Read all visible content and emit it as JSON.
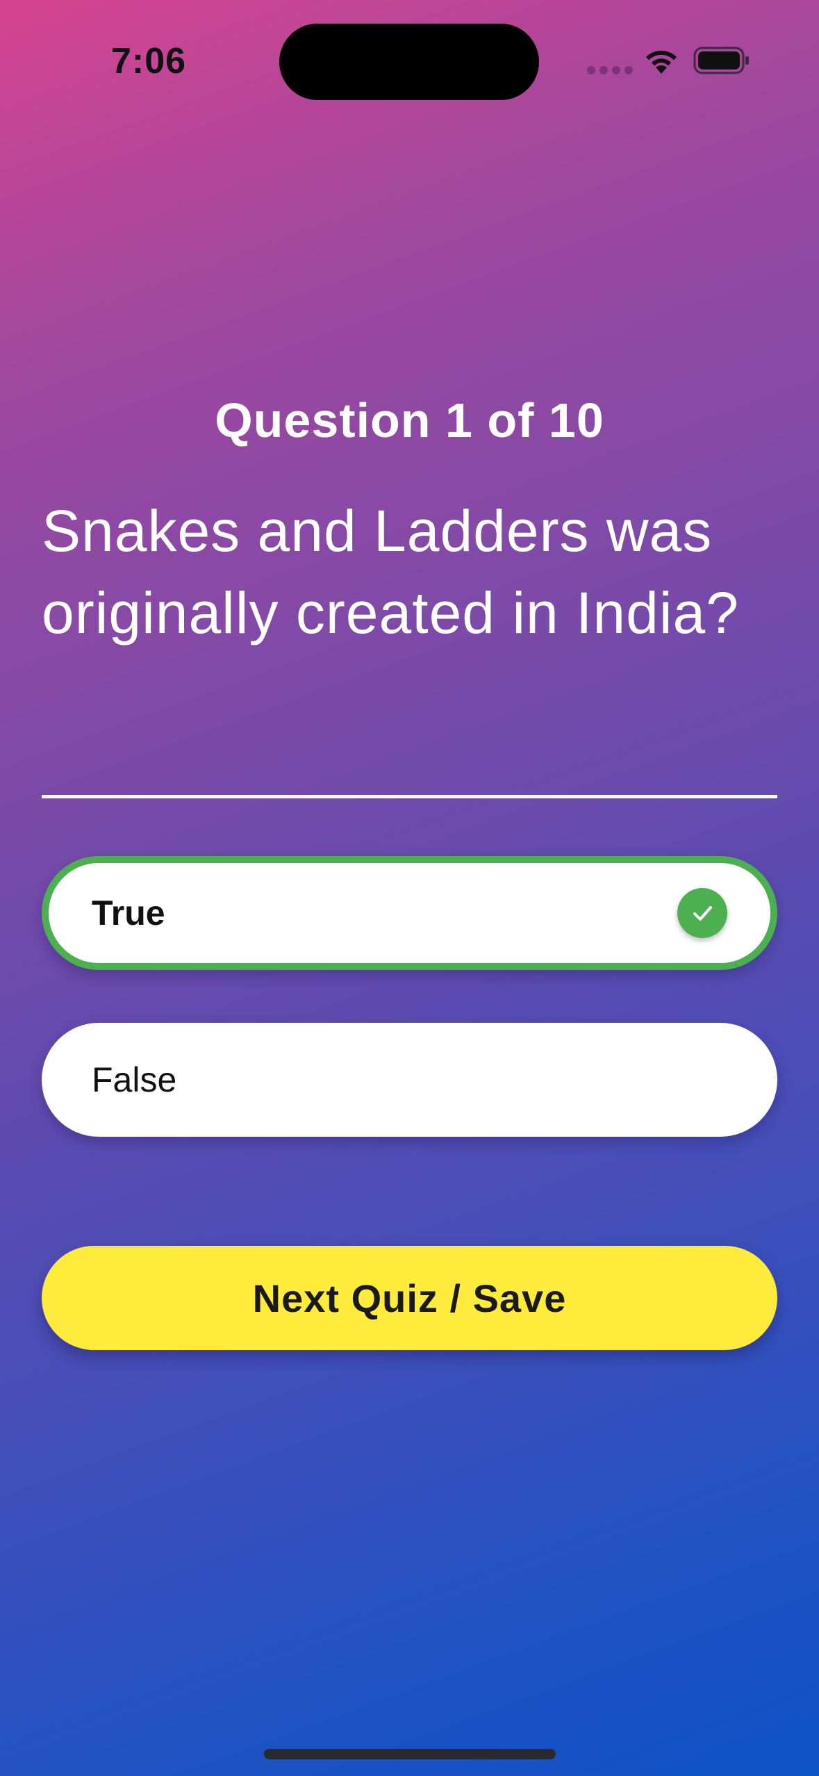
{
  "status_bar": {
    "time": "7:06",
    "icons": [
      "signal-dots-icon",
      "wifi-icon",
      "battery-icon"
    ]
  },
  "quiz": {
    "counter": "Question 1 of 10",
    "question": "Snakes and Ladders was originally created in India?",
    "options": [
      {
        "label": "True",
        "selected": true,
        "state": "correct"
      },
      {
        "label": "False",
        "selected": false
      }
    ],
    "next_button_label": "Next Quiz / Save"
  },
  "colors": {
    "gradient_top": "#d5448f",
    "gradient_bottom": "#0c53c7",
    "correct_green": "#4caf50",
    "button_yellow": "#ffeb3b",
    "option_background": "#ffffff"
  }
}
